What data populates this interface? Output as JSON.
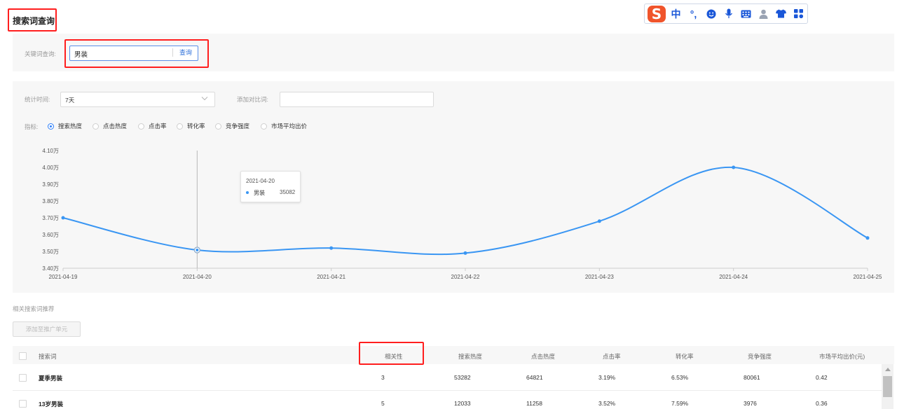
{
  "title": "搜索词查询",
  "ime": {
    "logo": "S",
    "items": [
      "中",
      "°,",
      "emoji-icon",
      "mic-icon",
      "keyboard-icon",
      "user-icon",
      "shirt-icon",
      "apps-icon"
    ]
  },
  "search": {
    "label": "关键词查询:",
    "value": "男装",
    "button": "查询"
  },
  "filters": {
    "time_label": "统计时间:",
    "time_value": "7天",
    "compare_label": "添加对比词:",
    "compare_value": "",
    "metric_label": "指标:",
    "metrics": [
      "搜索热度",
      "点击热度",
      "点击率",
      "转化率",
      "竞争强度",
      "市场平均出价"
    ],
    "selected_metric": "搜索热度"
  },
  "chart_data": {
    "type": "line",
    "x": [
      "2021-04-19",
      "2021-04-20",
      "2021-04-21",
      "2021-04-22",
      "2021-04-23",
      "2021-04-24",
      "2021-04-25"
    ],
    "ytick_labels": [
      "3.40万",
      "3.50万",
      "3.60万",
      "3.70万",
      "3.80万",
      "3.90万",
      "4.00万",
      "4.10万"
    ],
    "yticks": [
      34000,
      35000,
      36000,
      37000,
      38000,
      39000,
      40000,
      41000
    ],
    "ylim": [
      34000,
      41000
    ],
    "series": [
      {
        "name": "男装",
        "values": [
          37000,
          35082,
          35200,
          34900,
          36800,
          40000,
          35800
        ]
      }
    ],
    "grid": false,
    "colors": {
      "line": "#3a96f3"
    },
    "tooltip": {
      "date": "2021-04-20",
      "name": "男装",
      "value": "35082"
    }
  },
  "related": {
    "title": "相关搜索词推荐",
    "add_button": "添加至推广单元",
    "columns": [
      "搜索词",
      "相关性",
      "搜索热度",
      "点击热度",
      "点击率",
      "转化率",
      "竞争强度",
      "市场平均出价(元)"
    ],
    "rows": [
      [
        "夏季男装",
        "3",
        "53282",
        "64821",
        "3.19%",
        "6.53%",
        "80061",
        "0.42"
      ],
      [
        "13岁男装",
        "5",
        "12033",
        "11258",
        "3.52%",
        "7.59%",
        "3976",
        "0.36"
      ]
    ]
  },
  "colors": {
    "accent": "#2d7ff9",
    "highlight_border": "#ff1e1e",
    "panel_bg": "#f7f7f7"
  }
}
